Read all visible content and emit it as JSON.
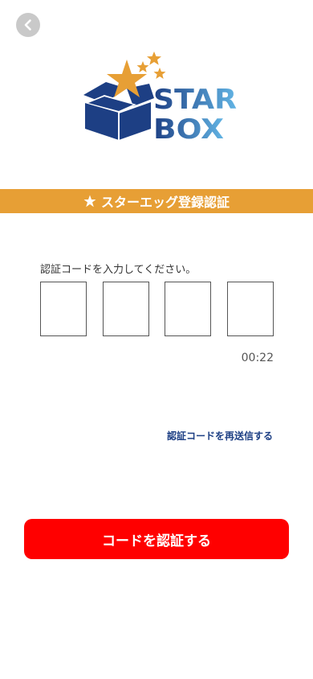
{
  "header": {
    "back_icon": "chevron-left-icon"
  },
  "logo": {
    "line1": "STAR",
    "line2": "BOX",
    "colors": {
      "box": "#1d3f84",
      "star": "#e79f35",
      "text_gradient_start": "#1d3f84",
      "text_gradient_end": "#62b4e4"
    }
  },
  "banner": {
    "icon": "star-icon",
    "title": "スターエッグ登録認証",
    "color": "#e79f35"
  },
  "verification": {
    "instruction": "認証コードを入力してください。",
    "code_digits": [
      "",
      "",
      "",
      ""
    ],
    "timer": "00:22",
    "resend_label": "認証コードを再送信する"
  },
  "submit": {
    "label": "コードを認証する",
    "color": "#ff0000"
  }
}
